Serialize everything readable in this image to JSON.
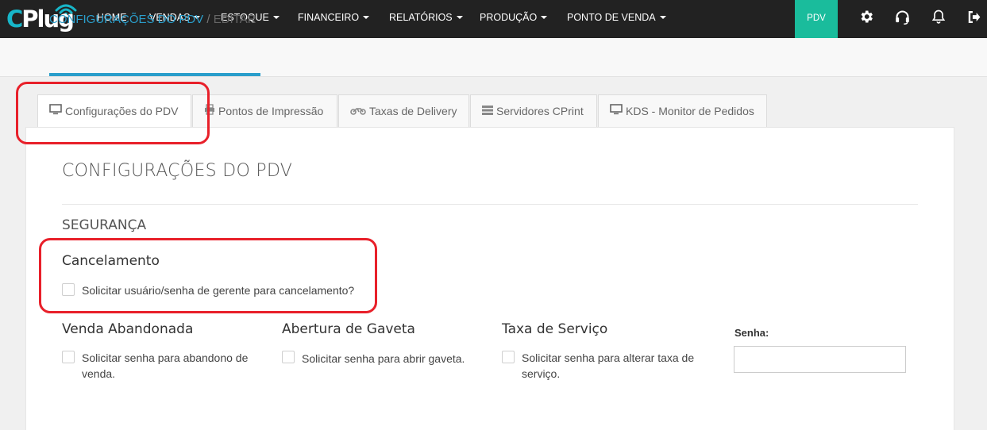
{
  "nav": {
    "logo": "CPlug",
    "items": [
      {
        "label": "HOME",
        "caret": false
      },
      {
        "label": "VENDAS",
        "caret": true
      },
      {
        "label": "ESTOQUE",
        "caret": true
      },
      {
        "label": "FINANCEIRO",
        "caret": true
      },
      {
        "label": "RELATÓRIOS",
        "caret": true
      },
      {
        "label": "PRODUÇÃO",
        "caret": true
      },
      {
        "label": "PONTO DE VENDA",
        "caret": true
      }
    ],
    "pdv_button": "PDV",
    "icons": [
      "gear-icon",
      "headset-icon",
      "bell-icon",
      "logout-icon"
    ],
    "accent_color": "#1abc9c",
    "bar_color": "#222222"
  },
  "breadcrumb": {
    "link": "CONFIGURAÇÕES DO PDV",
    "separator": "/",
    "current": "EDITAR",
    "link_color": "#2a9ecb"
  },
  "tabs": [
    {
      "label": "Configurações do PDV",
      "icon": "monitor-icon",
      "active": true
    },
    {
      "label": "Pontos de Impressão",
      "icon": "printer-icon",
      "active": false
    },
    {
      "label": "Taxas de Delivery",
      "icon": "motorcycle-icon",
      "active": false
    },
    {
      "label": "Servidores CPrint",
      "icon": "server-icon",
      "active": false
    },
    {
      "label": "KDS - Monitor de Pedidos",
      "icon": "monitor-icon",
      "active": false
    }
  ],
  "content": {
    "heading": "CONFIGURAÇÕES DO PDV",
    "section": "SEGURANÇA",
    "cancelamento": {
      "title": "Cancelamento",
      "checkbox": "Solicitar usuário/senha de gerente para cancelamento?",
      "checked": false
    },
    "venda_abandonada": {
      "title": "Venda Abandonada",
      "checkbox": "Solicitar senha para abandono de venda.",
      "checked": false
    },
    "abertura_gaveta": {
      "title": "Abertura de Gaveta",
      "checkbox": "Solicitar senha para abrir gaveta.",
      "checked": false
    },
    "taxa_servico": {
      "title": "Taxa de Serviço",
      "checkbox": "Solicitar senha para alterar taxa de serviço.",
      "checked": false
    },
    "senha": {
      "label": "Senha:",
      "value": "",
      "placeholder": ""
    }
  },
  "annotation_color": "#e8202a"
}
